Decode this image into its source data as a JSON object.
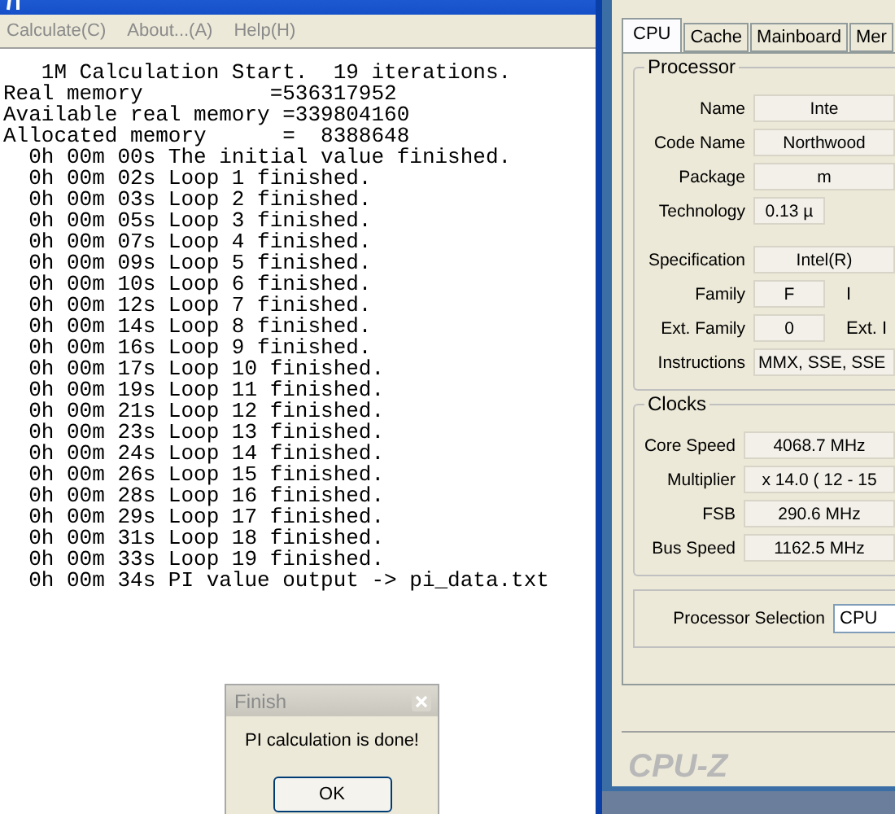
{
  "console_window": {
    "menu": [
      {
        "label": "Calculate(C)"
      },
      {
        "label": "About...(A)"
      },
      {
        "label": "Help(H)"
      }
    ],
    "output_lines": [
      "   1M Calculation Start.  19 iterations.",
      "Real memory          =536317952",
      "Available real memory =339804160",
      "Allocated memory      =  8388648",
      "  0h 00m 00s The initial value finished.",
      "  0h 00m 02s Loop 1 finished.",
      "  0h 00m 03s Loop 2 finished.",
      "  0h 00m 05s Loop 3 finished.",
      "  0h 00m 07s Loop 4 finished.",
      "  0h 00m 09s Loop 5 finished.",
      "  0h 00m 10s Loop 6 finished.",
      "  0h 00m 12s Loop 7 finished.",
      "  0h 00m 14s Loop 8 finished.",
      "  0h 00m 16s Loop 9 finished.",
      "  0h 00m 17s Loop 10 finished.",
      "  0h 00m 19s Loop 11 finished.",
      "  0h 00m 21s Loop 12 finished.",
      "  0h 00m 23s Loop 13 finished.",
      "  0h 00m 24s Loop 14 finished.",
      "  0h 00m 26s Loop 15 finished.",
      "  0h 00m 28s Loop 16 finished.",
      "  0h 00m 29s Loop 17 finished.",
      "  0h 00m 31s Loop 18 finished.",
      "  0h 00m 33s Loop 19 finished.",
      "  0h 00m 34s PI value output -> pi_data.txt"
    ]
  },
  "cpuz_window": {
    "tabs": [
      {
        "label": "CPU",
        "selected": true
      },
      {
        "label": "Cache",
        "selected": false
      },
      {
        "label": "Mainboard",
        "selected": false
      },
      {
        "label": "Mer",
        "selected": false
      }
    ],
    "processor": {
      "title": "Processor",
      "sections": [
        [
          {
            "label": "Name",
            "fields": [
              {
                "kind": "wide",
                "text": "Inte"
              }
            ]
          },
          {
            "label": "Code Name",
            "fields": [
              {
                "kind": "wide",
                "text": "Northwood"
              }
            ]
          },
          {
            "label": "Package",
            "fields": [
              {
                "kind": "wide",
                "text": "m"
              }
            ]
          },
          {
            "label": "Technology",
            "fields": [
              {
                "kind": "short",
                "text": "0.13 µ"
              }
            ]
          }
        ],
        [
          {
            "label": "Specification",
            "fields": [
              {
                "kind": "wide",
                "text": "Intel(R)"
              }
            ]
          },
          {
            "label": "Family",
            "fields": [
              {
                "kind": "short",
                "text": "F"
              },
              {
                "kind": "label",
                "text": "I"
              }
            ]
          },
          {
            "label": "Ext. Family",
            "fields": [
              {
                "kind": "short",
                "text": "0"
              },
              {
                "kind": "label",
                "text": "Ext. I"
              }
            ]
          },
          {
            "label": "Instructions",
            "fields": [
              {
                "kind": "list",
                "text": "MMX, SSE, SSE"
              }
            ]
          }
        ]
      ]
    },
    "clocks": {
      "title": "Clocks",
      "rows": [
        {
          "label": "Core Speed",
          "value": "4068.7 MHz"
        },
        {
          "label": "Multiplier",
          "value": "x 14.0  ( 12 - 15"
        },
        {
          "label": "FSB",
          "value": "290.6 MHz"
        },
        {
          "label": "Bus Speed",
          "value": "1162.5 MHz"
        }
      ]
    },
    "processor_selection": {
      "label": "Processor Selection",
      "value": "CPU"
    },
    "brand": "CPU-Z"
  },
  "dialog": {
    "title": "Finish",
    "message": "PI calculation is done!",
    "button": "OK"
  }
}
